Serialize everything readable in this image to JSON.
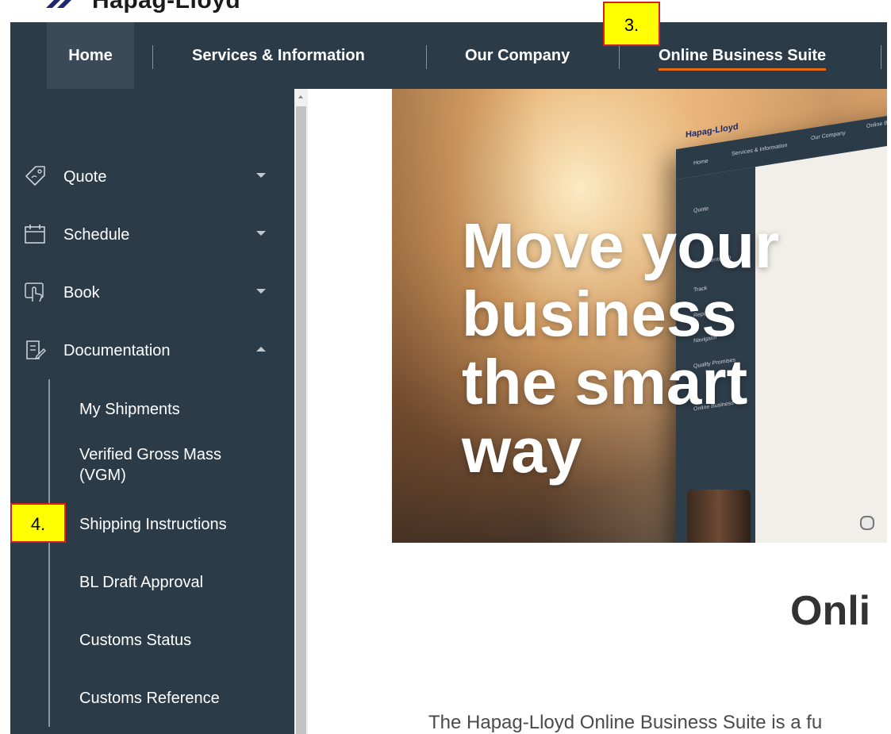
{
  "brand": {
    "logo_text": "Hapag-Lloyd"
  },
  "nav": {
    "items": [
      {
        "label": "Home"
      },
      {
        "label": "Services & Information"
      },
      {
        "label": "Our Company"
      },
      {
        "label": "Online Business Suite"
      }
    ],
    "active_index": 3,
    "accent_color": "#e8690e"
  },
  "annotations": {
    "step3": "3.",
    "step4": "4."
  },
  "sidebar": {
    "items": [
      {
        "label": "Quote",
        "icon": "tag-icon",
        "expanded": false
      },
      {
        "label": "Schedule",
        "icon": "calendar-icon",
        "expanded": false
      },
      {
        "label": "Book",
        "icon": "hand-pointer-icon",
        "expanded": false
      },
      {
        "label": "Documentation",
        "icon": "document-edit-icon",
        "expanded": true
      }
    ],
    "documentation_sub": [
      {
        "label": "My Shipments"
      },
      {
        "label": "Verified Gross Mass (VGM)"
      },
      {
        "label": "Shipping Instructions"
      },
      {
        "label": "BL Draft Approval"
      },
      {
        "label": "Customs Status"
      },
      {
        "label": "Customs Reference"
      }
    ]
  },
  "hero": {
    "lines": [
      "Move your",
      "business",
      "the smart",
      "way"
    ],
    "device_logo": "Hapag-Lloyd",
    "device_nav": [
      "Home",
      "Services & Information",
      "Our Company",
      "Online Bus"
    ],
    "device_menu": [
      "Quote",
      "Documentation",
      "Track",
      "Report",
      "Navigator",
      "Quality Promises",
      "Online Business Suite"
    ]
  },
  "content": {
    "title": "Onli",
    "intro": "The Hapag-Lloyd Online Business Suite is a fu"
  }
}
